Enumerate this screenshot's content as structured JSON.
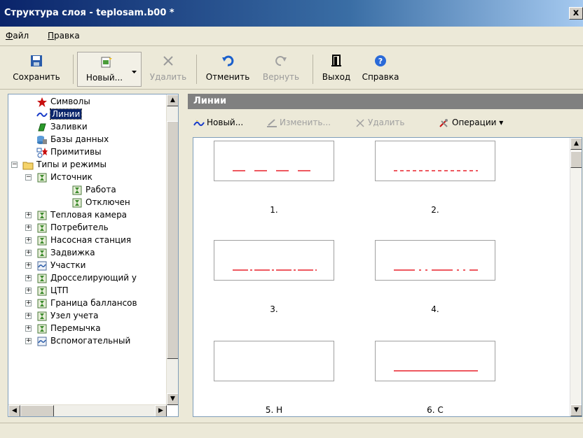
{
  "window": {
    "title": "Структура слоя - teplosam.b00 *",
    "close_glyph": "x"
  },
  "menu": [
    {
      "label_ul": "Ф",
      "label_rest": "айл"
    },
    {
      "label_ul": "П",
      "label_rest": "равка"
    }
  ],
  "toolbar": {
    "save": "Сохранить",
    "new": "Новый...",
    "delete": "Удалить",
    "undo": "Отменить",
    "redo": "Вернуть",
    "exit": "Выход",
    "help": "Справка"
  },
  "tree": {
    "items": [
      {
        "label": "Символы",
        "icon": "star-icon"
      },
      {
        "label": "Линии",
        "icon": "line-icon"
      },
      {
        "label": "Заливки",
        "icon": "fill-icon"
      },
      {
        "label": "Базы данных",
        "icon": "database-icon"
      },
      {
        "label": "Примитивы",
        "icon": "primitives-icon"
      },
      {
        "label": "Типы и режимы",
        "icon": "folder-icon"
      },
      {
        "label": "Источник",
        "icon": "type-icon"
      },
      {
        "label": "Работа",
        "icon": "mode-icon"
      },
      {
        "label": "Отключен",
        "icon": "mode-icon"
      },
      {
        "label": "Тепловая камера",
        "icon": "type-icon"
      },
      {
        "label": "Потребитель",
        "icon": "type-icon"
      },
      {
        "label": "Насосная станция",
        "icon": "type-icon"
      },
      {
        "label": "Задвижка",
        "icon": "type-icon"
      },
      {
        "label": "Участки",
        "icon": "section-icon"
      },
      {
        "label": "Дросселирующий у",
        "icon": "type-icon"
      },
      {
        "label": "ЦТП",
        "icon": "type-icon"
      },
      {
        "label": "Граница баллансов",
        "icon": "type-icon"
      },
      {
        "label": "Узел учета",
        "icon": "type-icon"
      },
      {
        "label": "Перемычка",
        "icon": "type-icon"
      },
      {
        "label": "Вспомогательный",
        "icon": "section-icon"
      }
    ]
  },
  "pane": {
    "title": "Линии",
    "toolbar": {
      "new": "Новый...",
      "edit": "Изменить...",
      "delete": "Удалить",
      "operations": "Операции"
    },
    "tiles": [
      {
        "caption": "1.",
        "style": "long-dash"
      },
      {
        "caption": "2.",
        "style": "short-dash"
      },
      {
        "caption": "3.",
        "style": "dash-dot"
      },
      {
        "caption": "4.",
        "style": "dash-dot-dot"
      },
      {
        "caption": "5. Н",
        "style": "empty"
      },
      {
        "caption": "6. С",
        "style": "solid"
      }
    ]
  },
  "colors": {
    "line_red": "#e8202a",
    "title_blue": "#0a246a",
    "pane_header": "#808080"
  }
}
